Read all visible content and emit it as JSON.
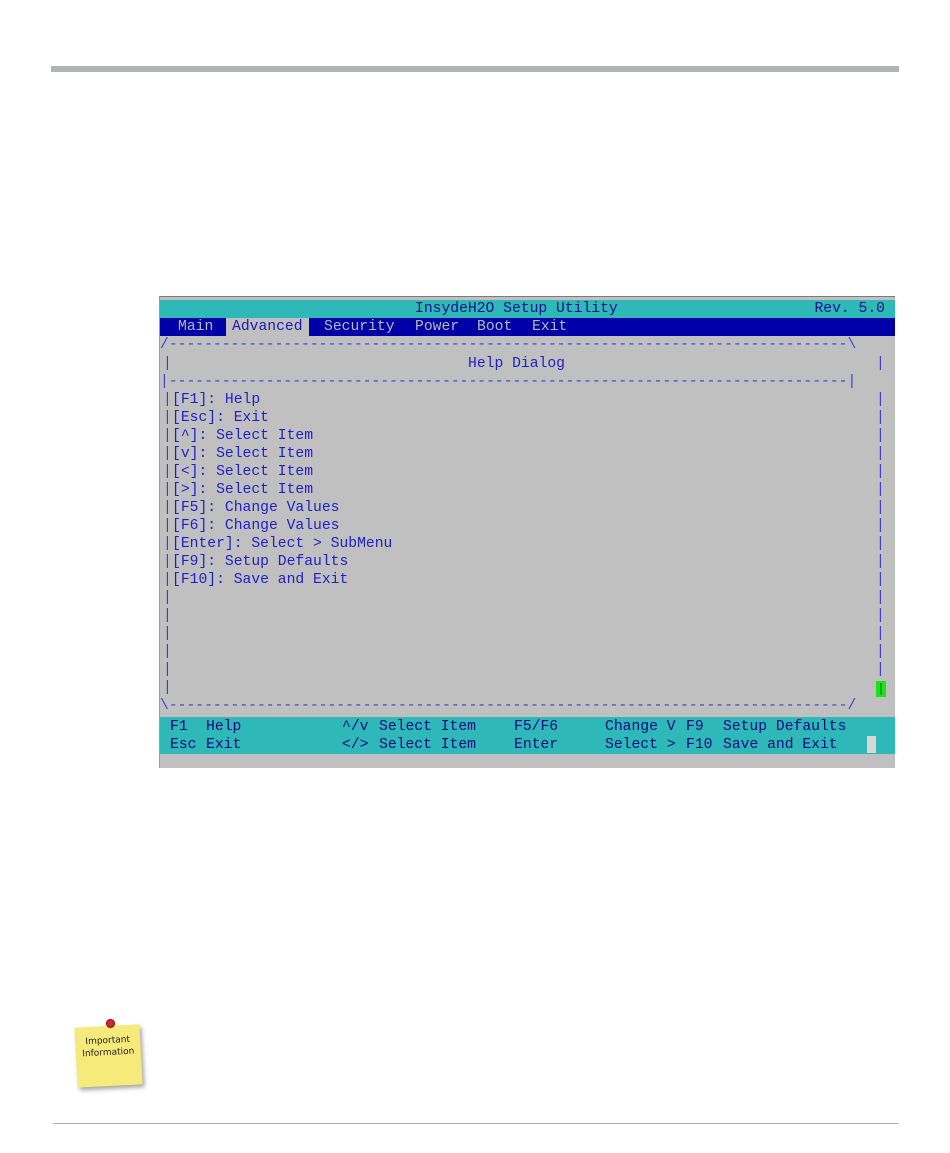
{
  "bios": {
    "title": "InsydeH2O Setup Utility",
    "revision": "Rev. 5.0",
    "menu": [
      {
        "label": "Main",
        "active": false
      },
      {
        "label": "Advanced",
        "active": true
      },
      {
        "label": "Security",
        "active": false
      },
      {
        "label": "Power",
        "active": false
      },
      {
        "label": "Boot",
        "active": false
      },
      {
        "label": "Exit",
        "active": false
      }
    ],
    "dialog_title": "Help Dialog",
    "help_items": [
      "[F1]: Help",
      "[Esc]: Exit",
      "[^]: Select Item",
      "[v]: Select Item",
      "[<]: Select Item",
      "[>]: Select Item",
      "[F5]: Change Values",
      "[F6]: Change Values",
      "[Enter]: Select > SubMenu",
      "[F9]: Setup Defaults",
      "[F10]: Save and Exit"
    ],
    "footer": {
      "row1": {
        "k1": "F1",
        "d1": "Help",
        "k2": "^/v",
        "d2": "Select Item",
        "k3": "F5/F6",
        "d3": "Change V",
        "k4": "F9",
        "d4": "Setup Defaults"
      },
      "row2": {
        "k1": "Esc",
        "d1": "Exit",
        "k2": "</>",
        "d2": "Select Item",
        "k3": "Enter",
        "d3": "Select >",
        "k4": "F10",
        "d4": "Save and Exit"
      }
    },
    "colors": {
      "title_bar": "#2fb8b8",
      "menu_bar": "#0000a8",
      "body": "#c0c0c0",
      "text": "#1f1fc8",
      "scroll_thumb": "#18e418"
    }
  },
  "note": {
    "line1": "Important",
    "line2": "Information",
    "color": "#f6ea7a"
  }
}
